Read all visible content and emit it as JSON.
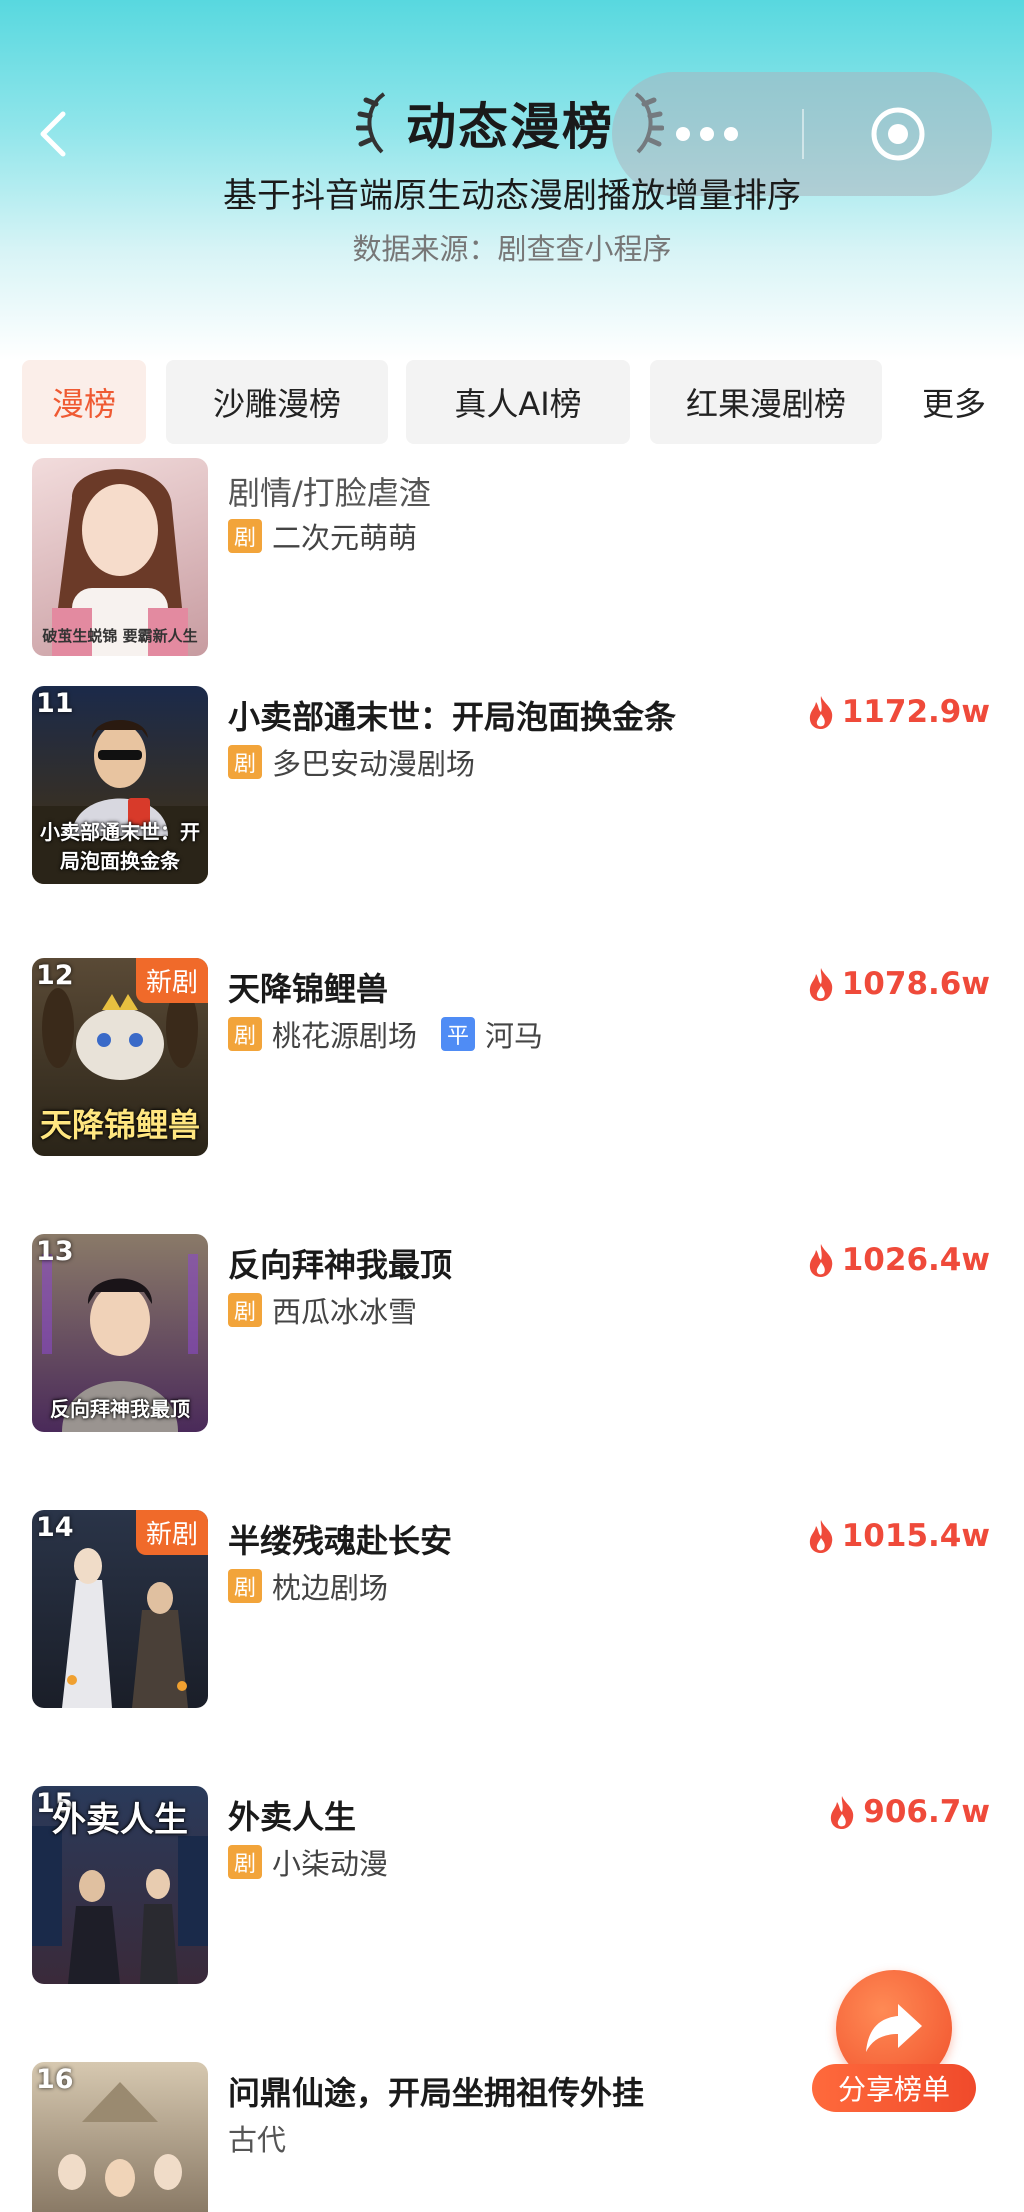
{
  "header": {
    "title": "动态漫榜",
    "subtitle": "基于抖音端原生动态漫剧播放增量排序",
    "source": "数据来源：剧查查小程序"
  },
  "tabs": [
    {
      "label": "漫榜",
      "active": true
    },
    {
      "label": "沙雕漫榜",
      "active": false
    },
    {
      "label": "真人AI榜",
      "active": false
    },
    {
      "label": "红果漫剧榜",
      "active": false
    },
    {
      "label": "更多",
      "active": false
    }
  ],
  "items": [
    {
      "rank": "",
      "title": "剧情/打脸虐渣",
      "studio": "二次元萌萌",
      "platform": "",
      "heat": "",
      "is_new": false,
      "cover_text": "破茧生蜕锦\n要霸新人生",
      "colors": [
        "#e8c9c9",
        "#b67b80"
      ]
    },
    {
      "rank": "11",
      "title": "小卖部通末世：开局泡面换金条",
      "studio": "多巴安动漫剧场",
      "platform": "",
      "heat": "1172.9w",
      "is_new": false,
      "cover_text": "小卖部通末世：开局泡面换金条",
      "colors": [
        "#1b2a4a",
        "#5a4a2a"
      ]
    },
    {
      "rank": "12",
      "title": "天降锦鲤兽",
      "studio": "桃花源剧场",
      "platform": "河马",
      "heat": "1078.6w",
      "is_new": true,
      "cover_text": "天降锦鲤兽",
      "colors": [
        "#4a3a2a",
        "#2a2418"
      ]
    },
    {
      "rank": "13",
      "title": "反向拜神我最顶",
      "studio": "西瓜冰冰雪",
      "platform": "",
      "heat": "1026.4w",
      "is_new": false,
      "cover_text": "反向拜神我最顶",
      "colors": [
        "#7a6a5a",
        "#5a2a6a"
      ]
    },
    {
      "rank": "14",
      "title": "半缕残魂赴长安",
      "studio": "枕边剧场",
      "platform": "",
      "heat": "1015.4w",
      "is_new": true,
      "cover_text": "",
      "colors": [
        "#1e2a3a",
        "#3a3040"
      ]
    },
    {
      "rank": "15",
      "title": "外卖人生",
      "studio": "小柒动漫",
      "platform": "",
      "heat": "906.7w",
      "is_new": false,
      "cover_text": "外卖人生",
      "colors": [
        "#2a3a5a",
        "#4a3a4a"
      ]
    },
    {
      "rank": "16",
      "title": "问鼎仙途，开局坐拥祖传外挂",
      "studio": "",
      "platform": "",
      "genre": "古代",
      "heat": "",
      "is_new": false,
      "cover_text": "",
      "colors": [
        "#c9b9a0",
        "#7a6a5a"
      ]
    }
  ],
  "tags": {
    "ju": "剧",
    "ping": "平",
    "new": "新剧"
  },
  "share": {
    "label": "分享榜单"
  },
  "colors": {
    "accent": "#ef5a33",
    "heat": "#ef4a3a",
    "tag_orange": "#f2a43a",
    "tag_blue": "#4f8cf5"
  }
}
